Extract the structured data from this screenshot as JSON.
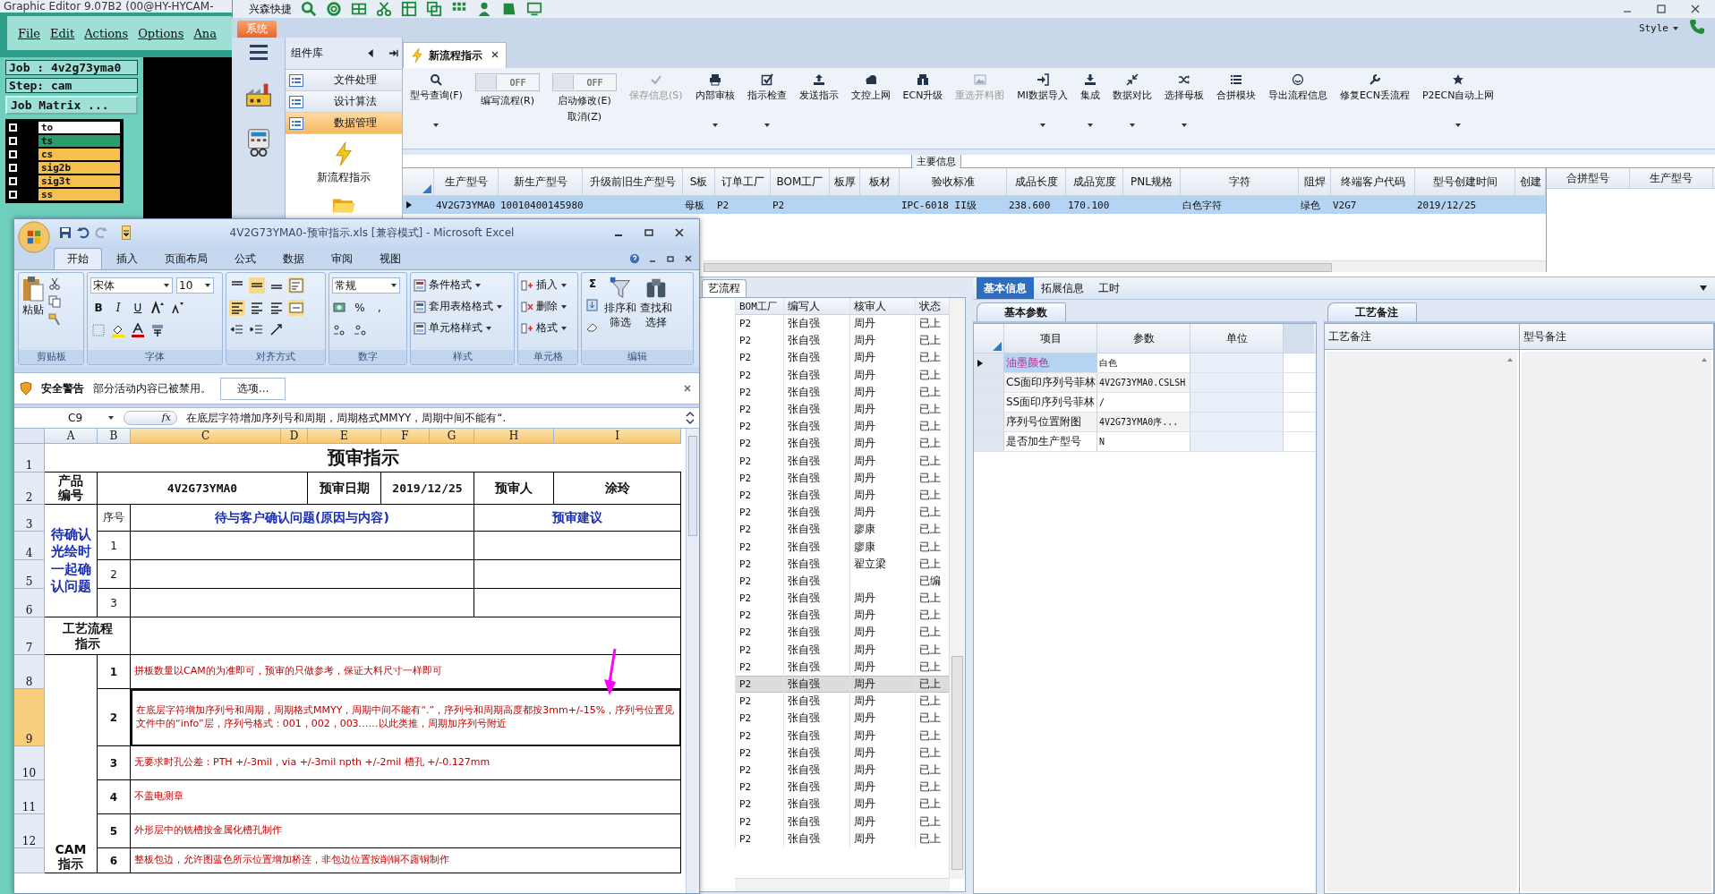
{
  "cam_app": {
    "title": "Graphic Editor 9.07B2 (00@HY-HYCAM-",
    "menu": [
      "File",
      "Edit",
      "Actions",
      "Options",
      "Ana"
    ],
    "job": "Job : 4v2g73yma0",
    "step": "Step: cam",
    "matrix_button": "Job Matrix ...",
    "layers": [
      {
        "name": "to",
        "color": "#ffffff",
        "checked": false
      },
      {
        "name": "ts",
        "color": "#2a9d6f",
        "checked": false
      },
      {
        "name": "cs",
        "color": "#f7c04e",
        "checked": false
      },
      {
        "name": "sig2b",
        "color": "#f7c04e",
        "checked": false
      },
      {
        "name": "sig3t",
        "color": "#f7c04e",
        "checked": false
      },
      {
        "name": "ss",
        "color": "#f7c04e",
        "checked": false
      }
    ]
  },
  "main_app": {
    "quick_title": "兴森快捷",
    "system_tab": "系统",
    "style_menu": "Style",
    "library": {
      "title": "组件库",
      "items": [
        {
          "label": "文件处理",
          "selected": false
        },
        {
          "label": "设计算法",
          "selected": false
        },
        {
          "label": "数据管理",
          "selected": true
        }
      ],
      "shortcut": "新流程指示"
    },
    "document_tab": "新流程指示",
    "toolbar": [
      {
        "kind": "button",
        "label": "型号查询(F)",
        "dropdown": true,
        "disabled": false
      },
      {
        "kind": "toggle",
        "label": "编写流程(R)",
        "state_text": "OFF",
        "on": false
      },
      {
        "kind": "toggle",
        "label": "启动修改(E)",
        "sublabel": "取消(Z)",
        "state_text": "OFF",
        "on": false
      },
      {
        "kind": "button",
        "label": "保存信息(S)",
        "dropdown": false,
        "disabled": true
      },
      {
        "kind": "button",
        "label": "内部审核",
        "dropdown": true,
        "disabled": false
      },
      {
        "kind": "button",
        "label": "指示检查",
        "dropdown": true,
        "disabled": false
      },
      {
        "kind": "button",
        "label": "发送指示",
        "dropdown": false,
        "disabled": false
      },
      {
        "kind": "button",
        "label": "文控上网",
        "dropdown": false,
        "disabled": false
      },
      {
        "kind": "button",
        "label": "ECN升级",
        "dropdown": false,
        "disabled": false
      },
      {
        "kind": "button",
        "label": "重选开料图",
        "dropdown": false,
        "disabled": true
      },
      {
        "kind": "button",
        "label": "MI数据导入",
        "dropdown": true,
        "disabled": false
      },
      {
        "kind": "button",
        "label": "集成",
        "dropdown": true,
        "disabled": false
      },
      {
        "kind": "button",
        "label": "数据对比",
        "dropdown": true,
        "disabled": false
      },
      {
        "kind": "button",
        "label": "选择母板",
        "dropdown": true,
        "disabled": false
      },
      {
        "kind": "button",
        "label": "合拼模块",
        "dropdown": false,
        "disabled": false
      },
      {
        "kind": "button",
        "label": "导出流程信息",
        "dropdown": false,
        "disabled": false
      },
      {
        "kind": "button",
        "label": "修复ECN丢流程",
        "dropdown": false,
        "disabled": false
      },
      {
        "kind": "button",
        "label": "P2ECN自动上网",
        "dropdown": true,
        "disabled": false
      }
    ],
    "main_info": {
      "legend": "主要信息",
      "columns": [
        "生产型号",
        "新生产型号",
        "升级前旧生产型号",
        "S板",
        "订单工厂",
        "BOM工厂",
        "板厚",
        "板材",
        "验收标准",
        "成品长度",
        "成品宽度",
        "PNL规格",
        "字符",
        "阻焊",
        "终端客户代码",
        "型号创建时间",
        "创建"
      ],
      "rows": [
        {
          "selected": true,
          "cells": [
            "4V2G73YMA0",
            "10010400145980",
            null,
            "母板",
            "P2",
            "P2",
            null,
            null,
            "IPC-6018 II级",
            "238.600",
            "170.100",
            null,
            "白色字符",
            "绿色",
            "V2G7",
            "2019/12/25",
            null
          ]
        }
      ]
    },
    "merge_table": {
      "columns": [
        "合拼型号",
        "生产型号"
      ]
    },
    "flow_list": {
      "tab": "艺流程",
      "columns": [
        "BOM工厂",
        "编写人",
        "核审人",
        "状态"
      ],
      "rows": [
        {
          "factory": "P2",
          "author": "张自强",
          "reviewer": "周丹",
          "status": "已上",
          "selected": false
        },
        {
          "factory": "P2",
          "author": "张自强",
          "reviewer": "周丹",
          "status": "已上",
          "selected": false
        },
        {
          "factory": "P2",
          "author": "张自强",
          "reviewer": "周丹",
          "status": "已上",
          "selected": false
        },
        {
          "factory": "P2",
          "author": "张自强",
          "reviewer": "周丹",
          "status": "已上",
          "selected": false
        },
        {
          "factory": "P2",
          "author": "张自强",
          "reviewer": "周丹",
          "status": "已上",
          "selected": false
        },
        {
          "factory": "P2",
          "author": "张自强",
          "reviewer": "周丹",
          "status": "已上",
          "selected": false
        },
        {
          "factory": "P2",
          "author": "张自强",
          "reviewer": "周丹",
          "status": "已上",
          "selected": false
        },
        {
          "factory": "P2",
          "author": "张自强",
          "reviewer": "周丹",
          "status": "已上",
          "selected": false
        },
        {
          "factory": "P2",
          "author": "张自强",
          "reviewer": "周丹",
          "status": "已上",
          "selected": false
        },
        {
          "factory": "P2",
          "author": "张自强",
          "reviewer": "周丹",
          "status": "已上",
          "selected": false
        },
        {
          "factory": "P2",
          "author": "张自强",
          "reviewer": "周丹",
          "status": "已上",
          "selected": false
        },
        {
          "factory": "P2",
          "author": "张自强",
          "reviewer": "周丹",
          "status": "已上",
          "selected": false
        },
        {
          "factory": "P2",
          "author": "张自强",
          "reviewer": "廖康",
          "status": "已上",
          "selected": false
        },
        {
          "factory": "P2",
          "author": "张自强",
          "reviewer": "廖康",
          "status": "已上",
          "selected": false
        },
        {
          "factory": "P2",
          "author": "张自强",
          "reviewer": "翟立梁",
          "status": "已上",
          "selected": false
        },
        {
          "factory": "P2",
          "author": "张自强",
          "status": "已编",
          "selected": false
        },
        {
          "factory": "P2",
          "author": "张自强",
          "reviewer": "周丹",
          "status": "已上",
          "selected": false
        },
        {
          "factory": "P2",
          "author": "张自强",
          "reviewer": "周丹",
          "status": "已上",
          "selected": false
        },
        {
          "factory": "P2",
          "author": "张自强",
          "reviewer": "周丹",
          "status": "已上",
          "selected": false
        },
        {
          "factory": "P2",
          "author": "张自强",
          "reviewer": "周丹",
          "status": "已上",
          "selected": false
        },
        {
          "factory": "P2",
          "author": "张自强",
          "reviewer": "周丹",
          "status": "已上",
          "selected": false
        },
        {
          "factory": "P2",
          "author": "张自强",
          "reviewer": "周丹",
          "status": "已上",
          "selected": true
        },
        {
          "factory": "P2",
          "author": "张自强",
          "reviewer": "周丹",
          "status": "已上",
          "selected": false
        },
        {
          "factory": "P2",
          "author": "张自强",
          "reviewer": "周丹",
          "status": "已上",
          "selected": false
        },
        {
          "factory": "P2",
          "author": "张自强",
          "reviewer": "周丹",
          "status": "已上",
          "selected": false
        },
        {
          "factory": "P2",
          "author": "张自强",
          "reviewer": "周丹",
          "status": "已上",
          "selected": false
        },
        {
          "factory": "P2",
          "author": "张自强",
          "reviewer": "周丹",
          "status": "已上",
          "selected": false
        },
        {
          "factory": "P2",
          "author": "张自强",
          "reviewer": "周丹",
          "status": "已上",
          "selected": false
        },
        {
          "factory": "P2",
          "author": "张自强",
          "reviewer": "周丹",
          "status": "已上",
          "selected": false
        },
        {
          "factory": "P2",
          "author": "张自强",
          "reviewer": "周丹",
          "status": "已上",
          "selected": false
        },
        {
          "factory": "P2",
          "author": "张自强",
          "reviewer": "周丹",
          "status": "已上",
          "selected": false
        }
      ]
    },
    "detail": {
      "tabs": [
        {
          "label": "基本信息",
          "selected": true
        },
        {
          "label": "拓展信息",
          "selected": false
        },
        {
          "label": "工时",
          "selected": false
        }
      ],
      "params": {
        "tab": "基本参数",
        "columns": [
          "项目",
          "参数",
          "单位"
        ],
        "rows": [
          {
            "item": "油墨颜色",
            "value": "白色",
            "selected": true
          },
          {
            "item": "CS面印序列号菲林",
            "value": "4V2G73YMA0.CSLSH",
            "selected": false
          },
          {
            "item": "SS面印序列号菲林",
            "value": "/",
            "selected": false
          },
          {
            "item": "序列号位置附图",
            "value": "4V2G73YMA0序...",
            "selected": false
          },
          {
            "item": "是否加生产型号",
            "value": "N",
            "selected": false
          }
        ]
      },
      "notes": {
        "tab": "工艺备注",
        "columns": [
          "工艺备注",
          "型号备注"
        ]
      }
    }
  },
  "excel": {
    "title": "4V2G73YMA0-预审指示.xls  [兼容模式] - Microsoft Excel",
    "tabs": [
      {
        "label": "开始",
        "selected": true
      },
      {
        "label": "插入",
        "selected": false
      },
      {
        "label": "页面布局",
        "selected": false
      },
      {
        "label": "公式",
        "selected": false
      },
      {
        "label": "数据",
        "selected": false
      },
      {
        "label": "审阅",
        "selected": false
      },
      {
        "label": "视图",
        "selected": false
      }
    ],
    "ribbon": {
      "paste": "粘贴",
      "font_name": "宋体",
      "font_size": "10",
      "bold": "B",
      "italic": "I",
      "underline": "U",
      "number_format": "常规",
      "percent": "%",
      "comma": ",",
      "styles": [
        "条件格式",
        "套用表格格式",
        "单元格样式"
      ],
      "cells": [
        "插入",
        "删除",
        "格式"
      ],
      "sum": "Σ",
      "sort": [
        "排序和",
        "筛选"
      ],
      "find": [
        "查找和",
        "选择"
      ],
      "groups": [
        "剪贴板",
        "字体",
        "对齐方式",
        "数字",
        "样式",
        "单元格",
        "编辑"
      ]
    },
    "security": {
      "title": "安全警告",
      "message": "部分活动内容已被禁用。",
      "button": "选项..."
    },
    "formula": {
      "cell": "C9",
      "fx": "fx",
      "value": "在底层字符增加序列号和周期，周期格式MMYY，周期中间不能有“."
    },
    "columns": [
      {
        "label": "A",
        "selected": false
      },
      {
        "label": "B",
        "selected": false
      },
      {
        "label": "C",
        "selected": true
      },
      {
        "label": "D",
        "selected": true
      },
      {
        "label": "E",
        "selected": true
      },
      {
        "label": "F",
        "selected": true
      },
      {
        "label": "G",
        "selected": true
      },
      {
        "label": "H",
        "selected": true
      },
      {
        "label": "I",
        "selected": true
      }
    ],
    "rows": [
      {
        "label": "1",
        "selected": false
      },
      {
        "label": "2",
        "selected": false
      },
      {
        "label": "3",
        "selected": false
      },
      {
        "label": "4",
        "selected": false
      },
      {
        "label": "5",
        "selected": false
      },
      {
        "label": "6",
        "selected": false
      },
      {
        "label": "7",
        "selected": false
      },
      {
        "label": "8",
        "selected": false
      },
      {
        "label": "9",
        "selected": true
      },
      {
        "label": "10",
        "selected": false
      },
      {
        "label": "11",
        "selected": false
      },
      {
        "label": "12",
        "selected": false
      }
    ],
    "sheet": {
      "title": "预审指示",
      "product_label": "产品编号",
      "product_code": "4V2G73YMA0",
      "date_label": "预审日期",
      "date": "2019/12/25",
      "reviewer_label": "预审人",
      "reviewer": "涂玲",
      "confirm_label": "待确认光绘时一起确认问题",
      "seq_label": "序号",
      "issue_header": "待与客户确认问题(原因与内容)",
      "advice_header": "预审建议",
      "confirm_rows": [
        "1",
        "2",
        "3"
      ],
      "flow_label": "工艺流程指示",
      "cam_label": "CAM指示",
      "instructions": [
        {
          "no": "1",
          "text": "拼板数量以CAM的为准即可，预审的只做参考，保证大料尺寸一样即可",
          "selected": false
        },
        {
          "no": "2",
          "text": "在底层字符增加序列号和周期，周期格式MMYY，周期中间不能有“.”，序列号和周期高度都按3mm+/-15%，序列号位置见文件中的“info”层，序列号格式：001，002，003……以此类推，周期加序列号附近",
          "selected": true
        },
        {
          "no": "3",
          "text": "无要求时孔公差：PTH +/-3mil，via +/-3mil npth +/-2mil   槽孔 +/-0.127mm",
          "selected": false
        },
        {
          "no": "4",
          "text": "不盖电测章",
          "selected": false
        },
        {
          "no": "5",
          "text": "外形层中的铣槽按金属化槽孔制作",
          "selected": false
        },
        {
          "no": "6",
          "text": "整板包边，允许图蓝色所示位置增加桥连，非包边位置按削铜不露铜制作",
          "selected": false
        }
      ]
    }
  }
}
